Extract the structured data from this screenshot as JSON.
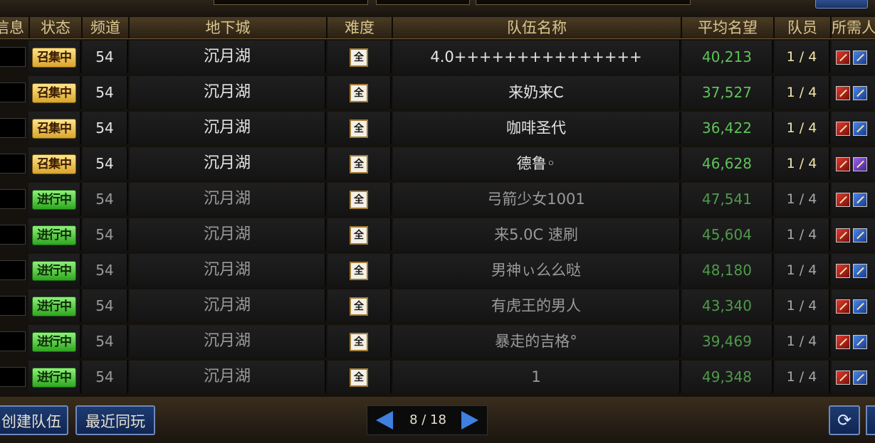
{
  "header": {
    "info": "信息",
    "status": "状态",
    "channel": "频道",
    "dungeon": "地下城",
    "difficulty": "难度",
    "team_name": "队伍名称",
    "avg_rep": "平均名望",
    "members": "队员",
    "required": "所需人"
  },
  "rows": [
    {
      "status": "召集中",
      "status_type": "gather",
      "channel": "54",
      "dungeon": "沉月湖",
      "difficulty": "全",
      "team_name": "4.0+++++++++++++++",
      "avg_rep": "40,213",
      "members": "1 / 4",
      "jobs": [
        "red",
        "blue"
      ]
    },
    {
      "status": "召集中",
      "status_type": "gather",
      "channel": "54",
      "dungeon": "沉月湖",
      "difficulty": "全",
      "team_name": "来奶来C",
      "avg_rep": "37,527",
      "members": "1 / 4",
      "jobs": [
        "red",
        "blue"
      ]
    },
    {
      "status": "召集中",
      "status_type": "gather",
      "channel": "54",
      "dungeon": "沉月湖",
      "difficulty": "全",
      "team_name": "咖啡圣代",
      "avg_rep": "36,422",
      "members": "1 / 4",
      "jobs": [
        "red",
        "blue"
      ]
    },
    {
      "status": "召集中",
      "status_type": "gather",
      "channel": "54",
      "dungeon": "沉月湖",
      "difficulty": "全",
      "team_name": "德鲁◦",
      "avg_rep": "46,628",
      "members": "1 / 4",
      "jobs": [
        "red",
        "purple"
      ]
    },
    {
      "status": "进行中",
      "status_type": "active",
      "channel": "54",
      "dungeon": "沉月湖",
      "difficulty": "全",
      "team_name": "弓箭少女1001",
      "avg_rep": "47,541",
      "members": "1 / 4",
      "jobs": [
        "red",
        "blue"
      ]
    },
    {
      "status": "进行中",
      "status_type": "active",
      "channel": "54",
      "dungeon": "沉月湖",
      "difficulty": "全",
      "team_name": "来5.0C 速刷",
      "avg_rep": "45,604",
      "members": "1 / 4",
      "jobs": [
        "red",
        "blue"
      ]
    },
    {
      "status": "进行中",
      "status_type": "active",
      "channel": "54",
      "dungeon": "沉月湖",
      "difficulty": "全",
      "team_name": "男神ぃ么么哒",
      "avg_rep": "48,180",
      "members": "1 / 4",
      "jobs": [
        "red",
        "blue"
      ]
    },
    {
      "status": "进行中",
      "status_type": "active",
      "channel": "54",
      "dungeon": "沉月湖",
      "difficulty": "全",
      "team_name": "有虎王的男人",
      "avg_rep": "43,340",
      "members": "1 / 4",
      "jobs": [
        "red",
        "blue"
      ]
    },
    {
      "status": "进行中",
      "status_type": "active",
      "channel": "54",
      "dungeon": "沉月湖",
      "difficulty": "全",
      "team_name": "暴走的吉格°",
      "avg_rep": "39,469",
      "members": "1 / 4",
      "jobs": [
        "red",
        "blue"
      ]
    },
    {
      "status": "进行中",
      "status_type": "active",
      "channel": "54",
      "dungeon": "沉月湖",
      "difficulty": "全",
      "team_name": "1",
      "avg_rep": "49,348",
      "members": "1 / 4",
      "jobs": [
        "red",
        "blue"
      ]
    }
  ],
  "footer": {
    "create_team": "创建队伍",
    "recent_played": "最近同玩",
    "page_label": "8 / 18",
    "refresh_icon": "refresh-icon"
  },
  "colors": {
    "gather_badge": "#f2c94c",
    "active_badge": "#4cd13a",
    "reputation": "#5fc25a",
    "button_blue": "#1d3b72"
  }
}
